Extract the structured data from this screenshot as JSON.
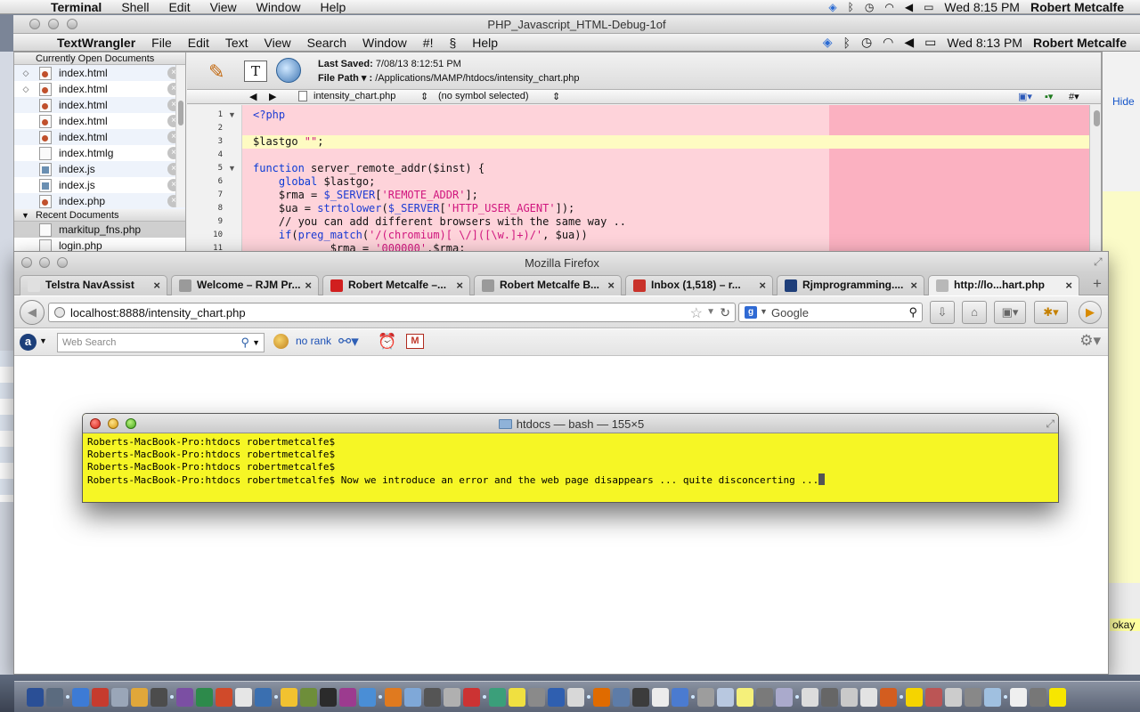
{
  "system_menubar": {
    "app": "Terminal",
    "items": [
      "Shell",
      "Edit",
      "View",
      "Window",
      "Help"
    ],
    "clock": "Wed 8:15 PM",
    "user": "Robert Metcalfe"
  },
  "background_window_title": "PHP_Javascript_HTML-Debug-1of",
  "tw_menubar": {
    "app": "TextWrangler",
    "items": [
      "File",
      "Edit",
      "Text",
      "View",
      "Search",
      "Window",
      "#!",
      "Help"
    ],
    "clock": "Wed 8:13 PM",
    "user": "Robert Metcalfe"
  },
  "textwrangler": {
    "open_docs_header": "Currently Open Documents",
    "open_docs": [
      {
        "name": "index.html",
        "type": "html",
        "mark": "◇"
      },
      {
        "name": "index.html",
        "type": "html",
        "mark": "◇"
      },
      {
        "name": "index.html",
        "type": "html",
        "mark": ""
      },
      {
        "name": "index.html",
        "type": "html",
        "mark": ""
      },
      {
        "name": "index.html",
        "type": "html",
        "mark": ""
      },
      {
        "name": "index.htmlg",
        "type": "plain",
        "mark": ""
      },
      {
        "name": "index.js",
        "type": "js",
        "mark": ""
      },
      {
        "name": "index.js",
        "type": "js",
        "mark": ""
      },
      {
        "name": "index.php",
        "type": "php",
        "mark": ""
      }
    ],
    "recent_header": "Recent Documents",
    "recent_docs": [
      "markitup_fns.php",
      "login.php"
    ],
    "last_saved_label": "Last Saved:",
    "last_saved_value": "7/08/13 8:12:51 PM",
    "file_path_label": "File Path ▾ :",
    "file_path_value": "/Applications/MAMP/htdocs/intensity_chart.php",
    "nav_file": "intensity_chart.php",
    "nav_symbol": "(no symbol selected)",
    "code_lines": [
      {
        "n": "1",
        "fold": "▼",
        "text": "<?php"
      },
      {
        "n": "2",
        "fold": "",
        "text": ""
      },
      {
        "n": "3",
        "fold": "",
        "text": "$lastgo \"\";"
      },
      {
        "n": "4",
        "fold": "",
        "text": ""
      },
      {
        "n": "5",
        "fold": "▼",
        "text": "function server_remote_addr($inst) {"
      },
      {
        "n": "6",
        "fold": "",
        "text": "    global $lastgo;"
      },
      {
        "n": "7",
        "fold": "",
        "text": "    $rma = $_SERVER['REMOTE_ADDR'];"
      },
      {
        "n": "8",
        "fold": "",
        "text": "    $ua = strtolower($_SERVER['HTTP_USER_AGENT']);"
      },
      {
        "n": "9",
        "fold": "",
        "text": "    // you can add different browsers with the same way .."
      },
      {
        "n": "10",
        "fold": "",
        "text": "    if(preg_match('/(chromium)[ \\/]([\\w.]+)/', $ua))"
      },
      {
        "n": "11",
        "fold": "",
        "text": "            $rma = '000000'.$rma;"
      }
    ]
  },
  "right_window": {
    "hide": "Hide",
    "okay": "okay"
  },
  "firefox": {
    "title": "Mozilla Firefox",
    "tabs": [
      {
        "label": "Telstra NavAssist",
        "color": "#e0e0e0",
        "active": false
      },
      {
        "label": "Welcome – RJM Pr...",
        "color": "#9a9a9a",
        "active": false
      },
      {
        "label": "Robert Metcalfe –...",
        "color": "#d11f1f",
        "active": false
      },
      {
        "label": "Robert Metcalfe B...",
        "color": "#9a9a9a",
        "active": false
      },
      {
        "label": "Inbox (1,518) – r...",
        "color": "#c9322a",
        "active": false
      },
      {
        "label": "Rjmprogramming....",
        "color": "#1f3f7a",
        "active": false
      },
      {
        "label": "http://lo...hart.php",
        "color": "#b8b8b8",
        "active": true
      }
    ],
    "url": "localhost:8888/intensity_chart.php",
    "search_placeholder": "Google",
    "web_search_placeholder": "Web Search",
    "rank_text": "no rank"
  },
  "terminal": {
    "title": "htdocs — bash — 155×5",
    "lines": [
      "Roberts-MacBook-Pro:htdocs robertmetcalfe$",
      "Roberts-MacBook-Pro:htdocs robertmetcalfe$",
      "Roberts-MacBook-Pro:htdocs robertmetcalfe$",
      "Roberts-MacBook-Pro:htdocs robertmetcalfe$ Now we introduce an error and the web page disappears ... quite disconcerting ..."
    ]
  },
  "colors": {
    "terminal_bg": "#f6f625",
    "code_bg": "#fed3da",
    "current_line": "#fefbc2"
  }
}
